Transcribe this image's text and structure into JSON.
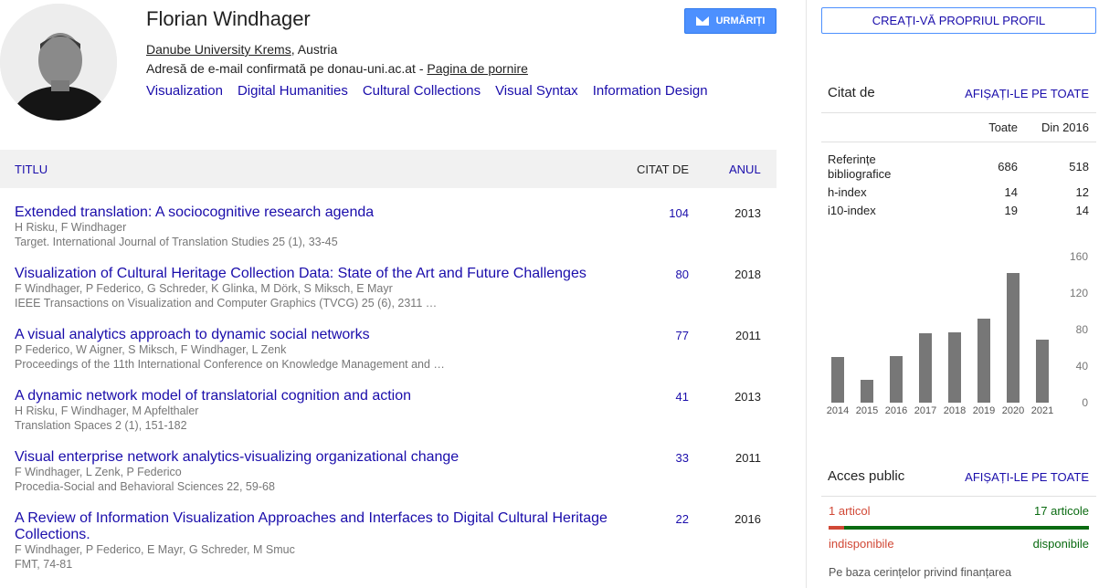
{
  "profile": {
    "name": "Florian Windhager",
    "affiliation_link": "Danube University Krems",
    "affiliation_rest": ", Austria",
    "email_text": "Adresă de e-mail confirmată pe donau-uni.ac.at - ",
    "homepage": "Pagina de pornire",
    "interests": [
      "Visualization",
      "Digital Humanities",
      "Cultural Collections",
      "Visual Syntax",
      "Information Design"
    ],
    "follow_label": "URMĂRIȚI"
  },
  "table": {
    "col_title": "TITLU",
    "col_cited": "CITAT DE",
    "col_year": "ANUL",
    "rows": [
      {
        "title": "Extended translation: A sociocognitive research agenda",
        "authors": "H Risku, F Windhager",
        "venue": "Target. International Journal of Translation Studies 25 (1), 33-45",
        "cited": "104",
        "year": "2013"
      },
      {
        "title": "Visualization of Cultural Heritage Collection Data: State of the Art and Future Challenges",
        "authors": "F Windhager, P Federico, G Schreder, K Glinka, M Dörk, S Miksch, E Mayr",
        "venue": "IEEE Transactions on Visualization and Computer Graphics (TVCG) 25 (6), 2311 …",
        "cited": "80",
        "year": "2018"
      },
      {
        "title": "A visual analytics approach to dynamic social networks",
        "authors": "P Federico, W Aigner, S Miksch, F Windhager, L Zenk",
        "venue": "Proceedings of the 11th International Conference on Knowledge Management and …",
        "cited": "77",
        "year": "2011"
      },
      {
        "title": "A dynamic network model of translatorial cognition and action",
        "authors": "H Risku, F Windhager, M Apfelthaler",
        "venue": "Translation Spaces 2 (1), 151-182",
        "cited": "41",
        "year": "2013"
      },
      {
        "title": "Visual enterprise network analytics-visualizing organizational change",
        "authors": "F Windhager, L Zenk, P Federico",
        "venue": "Procedia-Social and Behavioral Sciences 22, 59-68",
        "cited": "33",
        "year": "2011"
      },
      {
        "title": "A Review of Information Visualization Approaches and Interfaces to Digital Cultural Heritage Collections.",
        "authors": "F Windhager, P Federico, E Mayr, G Schreder, M Smuc",
        "venue": "FMT, 74-81",
        "cited": "22",
        "year": "2016"
      }
    ]
  },
  "sidebar": {
    "create_profile": "CREAȚI-VĂ PROPRIUL PROFIL",
    "cited_by": "Citat de",
    "show_all": "AFIȘAȚI-LE PE TOATE",
    "col_all": "Toate",
    "col_since": "Din 2016",
    "stats": [
      {
        "label": "Referințe bibliografice",
        "all": "686",
        "since": "518"
      },
      {
        "label": "h-index",
        "all": "14",
        "since": "12"
      },
      {
        "label": "i10-index",
        "all": "19",
        "since": "14"
      }
    ],
    "public_access": "Acces public",
    "show_all_2": "AFIȘAȚI-LE PE TOATE",
    "unavailable_count": "1 articol",
    "available_count": "17 articole",
    "unavailable_label": "indisponibile",
    "available_label": "disponibile",
    "funding_note": "Pe baza cerințelor privind finanțarea",
    "colors": {
      "bar": "#777777",
      "red": "#d14836",
      "green": "#0a6b11",
      "link": "#1a0dab"
    }
  },
  "chart_data": {
    "type": "bar",
    "categories": [
      "2014",
      "2015",
      "2016",
      "2017",
      "2018",
      "2019",
      "2020",
      "2021"
    ],
    "values": [
      50,
      25,
      51,
      76,
      77,
      92,
      142,
      69
    ],
    "yticks": [
      "160",
      "120",
      "80",
      "40",
      "0"
    ],
    "ylim": [
      0,
      160
    ]
  }
}
